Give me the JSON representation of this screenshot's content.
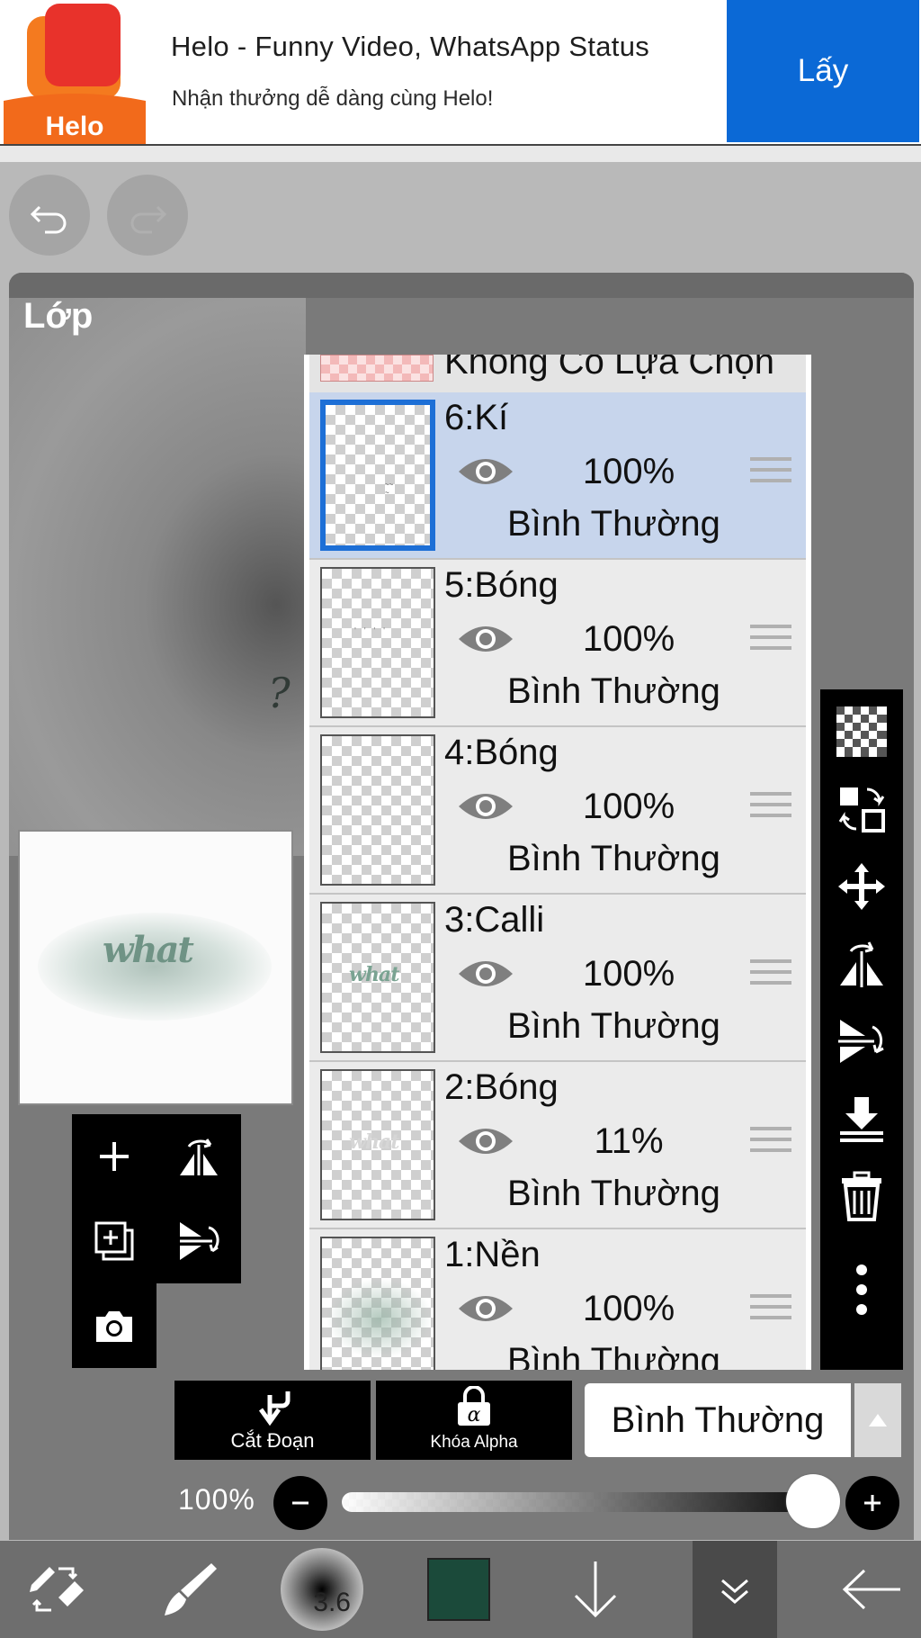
{
  "ad": {
    "title": "Helo - Funny Video, WhatsApp Status",
    "subtitle": "Nhận thưởng dễ dàng cùng Helo!",
    "logo_text": "Helo",
    "cta": "Lấy"
  },
  "panel": {
    "title": "Lớp"
  },
  "layers_header": "Không Có Lựa Chọn",
  "layers": [
    {
      "name": "6:Kí",
      "opacity": "100%",
      "mode": "Bình Thường",
      "selected": true
    },
    {
      "name": "5:Bóng",
      "opacity": "100%",
      "mode": "Bình Thường"
    },
    {
      "name": "4:Bóng",
      "opacity": "100%",
      "mode": "Bình Thường"
    },
    {
      "name": "3:Calli",
      "opacity": "100%",
      "mode": "Bình Thường"
    },
    {
      "name": "2:Bóng",
      "opacity": "11%",
      "mode": "Bình Thường"
    },
    {
      "name": "1:Nền",
      "opacity": "100%",
      "mode": "Bình Thường"
    }
  ],
  "bottom_controls": {
    "clip_label": "Cắt Đoạn",
    "alpha_lock_label": "Khóa Alpha",
    "blend_mode": "Bình Thường",
    "opacity_label": "100%",
    "opacity_value": 1.0
  },
  "brush": {
    "size": "3.6"
  },
  "colors": {
    "current": "#1b4a3a",
    "selected_blue": "#1d6fd6",
    "ad_button": "#0b69d6"
  },
  "preview": {
    "script_text": "what"
  }
}
